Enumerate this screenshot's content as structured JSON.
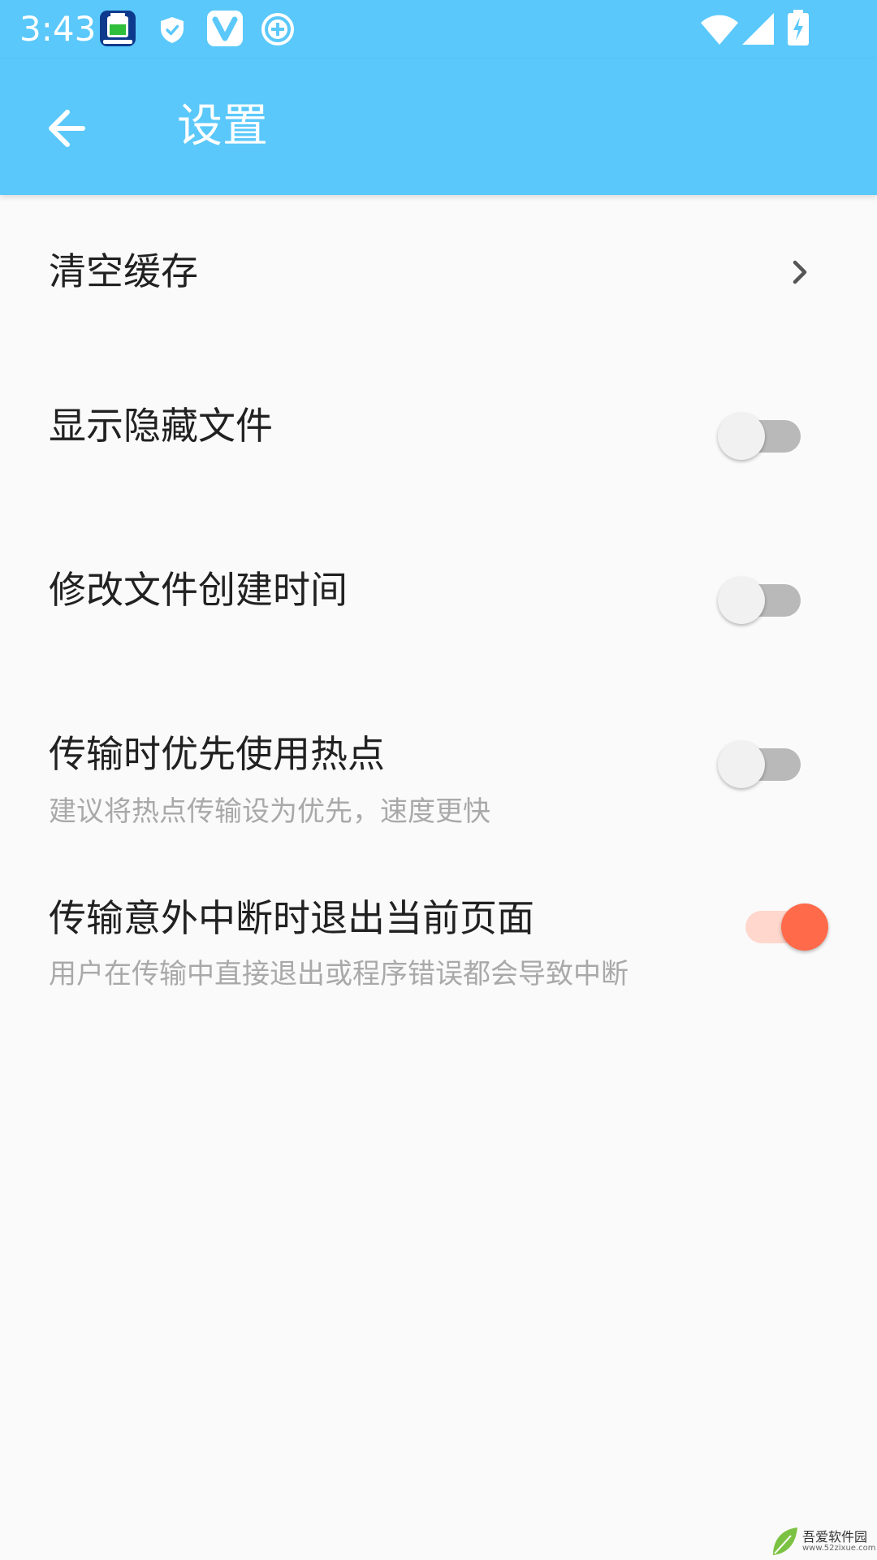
{
  "status_bar": {
    "time": "3:43",
    "left_icons": [
      "battery-app-icon",
      "shield-icon",
      "v-app-icon",
      "add-circle-icon"
    ],
    "right_icons": [
      "wifi-icon",
      "cell-signal-icon",
      "battery-charging-icon"
    ]
  },
  "app_bar": {
    "back_icon": "arrow-back-icon",
    "title": "设置"
  },
  "settings": [
    {
      "title": "清空缓存",
      "control": "chevron"
    },
    {
      "title": "显示隐藏文件",
      "control": "switch",
      "on": false
    },
    {
      "title": "修改文件创建时间",
      "control": "switch",
      "on": false
    },
    {
      "title": "传输时优先使用热点",
      "subtitle": "建议将热点传输设为优先，速度更快",
      "control": "switch",
      "on": false
    },
    {
      "title": "传输意外中断时退出当前页面",
      "subtitle": "用户在传输中直接退出或程序错误都会导致中断",
      "control": "switch",
      "on": true
    }
  ],
  "colors": {
    "primary": "#5ac8fa",
    "accent": "#ff6a4b",
    "background": "#fafafa"
  },
  "watermark": {
    "brand": "吾爱软件园",
    "url": "www.52zixue.com"
  }
}
